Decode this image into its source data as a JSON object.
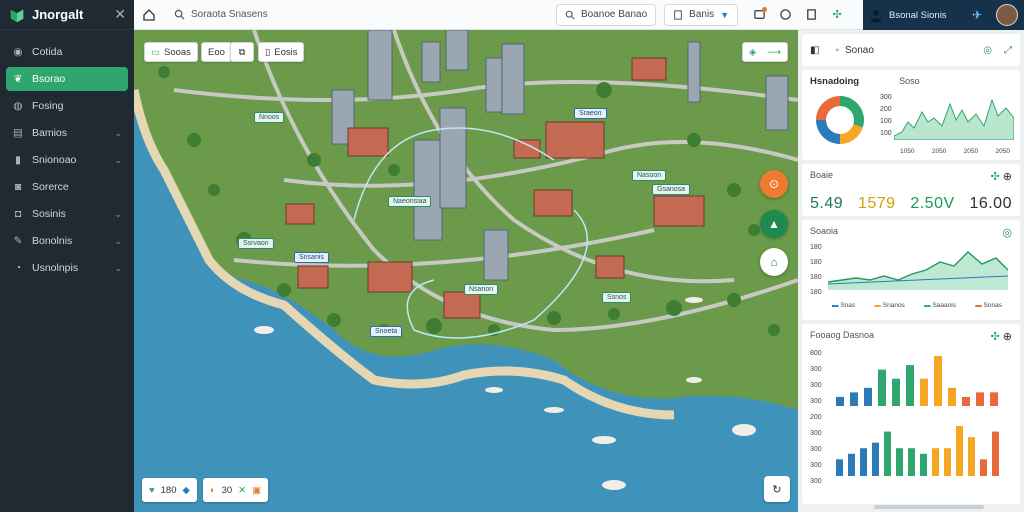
{
  "app": {
    "name": "Jnorgalt"
  },
  "sidebar": {
    "items": [
      {
        "label": "Cotida",
        "icon": "dashboard-icon",
        "active": false,
        "chevron": false
      },
      {
        "label": "Bsorao",
        "icon": "leaf-icon",
        "active": true,
        "chevron": false
      },
      {
        "label": "Fosing",
        "icon": "globe-icon",
        "active": false,
        "chevron": false
      },
      {
        "label": "Bamios",
        "icon": "layers-icon",
        "active": false,
        "chevron": true
      },
      {
        "label": "Snionoao",
        "icon": "folder-icon",
        "active": false,
        "chevron": true
      },
      {
        "label": "Sorerce",
        "icon": "chat-icon",
        "active": false,
        "chevron": false
      },
      {
        "label": "Sosinis",
        "icon": "settings-icon",
        "active": false,
        "chevron": true
      },
      {
        "label": "Bonolnis",
        "icon": "pin-icon",
        "active": false,
        "chevron": true
      },
      {
        "label": "Usnolnpis",
        "icon": "info-icon",
        "active": false,
        "chevron": true
      }
    ]
  },
  "topbar": {
    "search_value": "Soraota Snasens",
    "pill1_label": "Boanoe Banao",
    "pill2_label": "Banis",
    "user_name": "Bsonal Sionis"
  },
  "map": {
    "chips": [
      "Sooas",
      "Eoo",
      "Eosis"
    ],
    "labels": [
      "Nnoos",
      "Naeonsiaa",
      "Ssrvaon",
      "Snsanis",
      "Nasoon",
      "Gsanosa",
      "Nsanon",
      "Ssnos",
      "Snoeta",
      "Sraeon"
    ],
    "bottom": {
      "a": "180",
      "b": "30"
    },
    "accent": "#2fa66d",
    "fab_colors": {
      "orange": "#f07a2e",
      "green": "#1e8a4e"
    }
  },
  "panel": {
    "header": {
      "title": "Sonao"
    },
    "analysis": {
      "title": "Hsnadoing",
      "sub": "Soso",
      "donut": [
        0.3,
        0.2,
        0.25,
        0.25
      ],
      "donut_colors": [
        "#2fa66d",
        "#f5a623",
        "#2b7bb9",
        "#e86a3a"
      ],
      "axis": [
        "300",
        "200",
        "100",
        "100"
      ],
      "x_labels": [
        "1050",
        "2050",
        "2050",
        "2050"
      ]
    },
    "kpi": {
      "title": "Boaie",
      "values": [
        "5.49",
        "1579",
        "2.50V",
        "16.00"
      ],
      "colors": [
        "#1f7a4d",
        "#c9a20f",
        "#1f9a58",
        "#2b3138"
      ]
    },
    "trend": {
      "title": "Soaoia",
      "y_labels": [
        "180",
        "180",
        "180",
        "180"
      ],
      "legend": [
        "Snas",
        "Snanos",
        "Saaanis",
        "Sonas"
      ]
    },
    "bars": {
      "title": "Fooaog Dasnoa",
      "y_labels": [
        "800",
        "300",
        "300",
        "300",
        "200",
        "300",
        "300",
        "300",
        "300"
      ],
      "group1": [
        2,
        3,
        4,
        8,
        6,
        9,
        6,
        11,
        4,
        2,
        3,
        3
      ],
      "group2": [
        3,
        4,
        5,
        6,
        8,
        5,
        5,
        4,
        5,
        5,
        9,
        7,
        3,
        8
      ],
      "colors": [
        "#2b7bb9",
        "#2fa66d",
        "#f5a623",
        "#e86a3a"
      ]
    }
  }
}
